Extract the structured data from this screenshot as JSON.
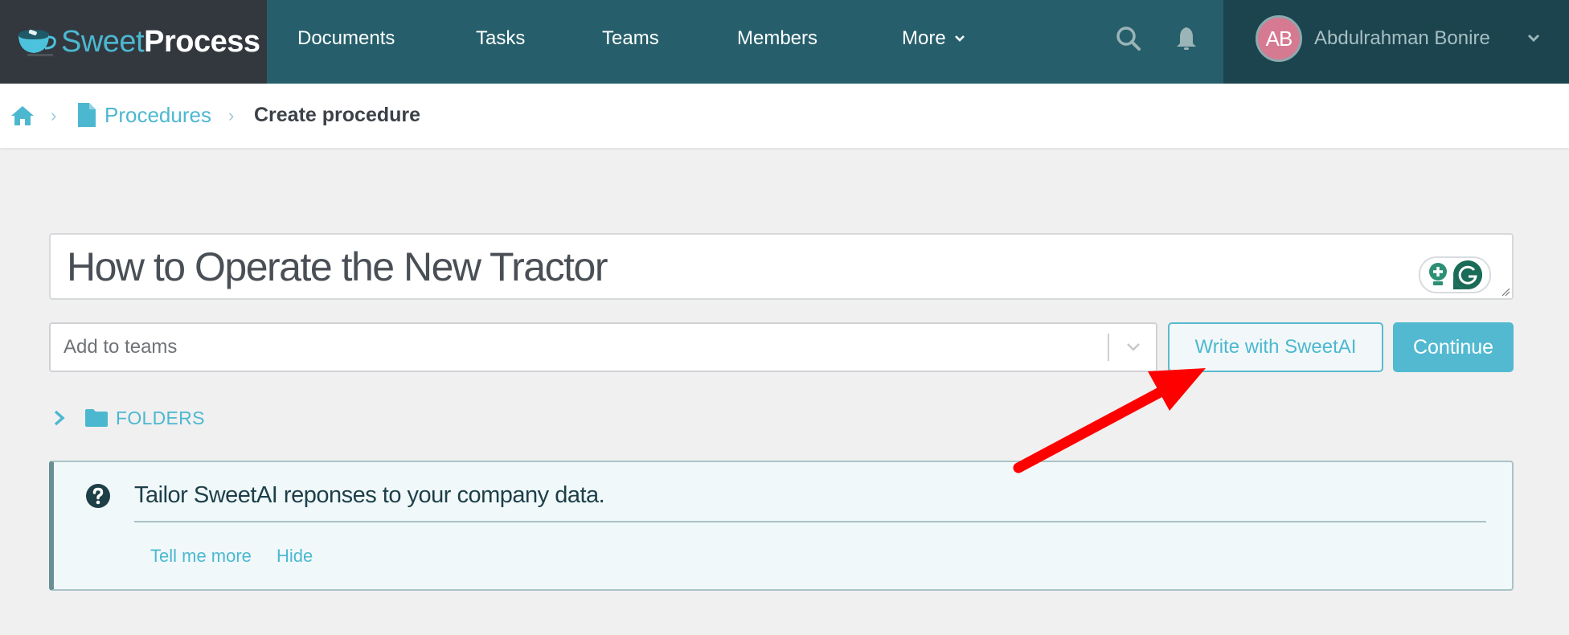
{
  "header": {
    "logo": {
      "part1": "Sweet",
      "part2": "Process",
      "icon": "coffee-cup-icon"
    },
    "nav": [
      {
        "label": "Documents"
      },
      {
        "label": "Tasks"
      },
      {
        "label": "Teams"
      },
      {
        "label": "Members"
      },
      {
        "label": "More",
        "icon": "chevron-down-icon"
      }
    ],
    "icons": {
      "search": "search-icon",
      "notifications": "bell-icon"
    },
    "user": {
      "initials": "AB",
      "name": "Abdulrahman Bonire",
      "avatar_color": "#d67a92"
    }
  },
  "breadcrumb": {
    "home_icon": "home-icon",
    "separator": "›",
    "items": [
      {
        "label": "Procedures",
        "icon": "document-icon"
      },
      {
        "label": "Create procedure"
      }
    ]
  },
  "form": {
    "title_value": "How to Operate the New Tractor",
    "teams_placeholder": "Add to teams",
    "write_ai_label": "Write with SweetAI",
    "continue_label": "Continue",
    "folders_label": "FOLDERS"
  },
  "info_box": {
    "icon": "question-circle-icon",
    "message": "Tailor SweetAI reponses to your company data.",
    "links": [
      {
        "label": "Tell me more"
      },
      {
        "label": "Hide"
      }
    ]
  },
  "annotation": {
    "type": "red-arrow",
    "color": "#ff0000",
    "points_to": "Write with SweetAI"
  },
  "colors": {
    "brand_teal": "#265f6b",
    "brand_dark": "#33383f",
    "user_area": "#1b444e",
    "accent": "#4cb8d0",
    "continue_bg": "#52b9d0"
  }
}
